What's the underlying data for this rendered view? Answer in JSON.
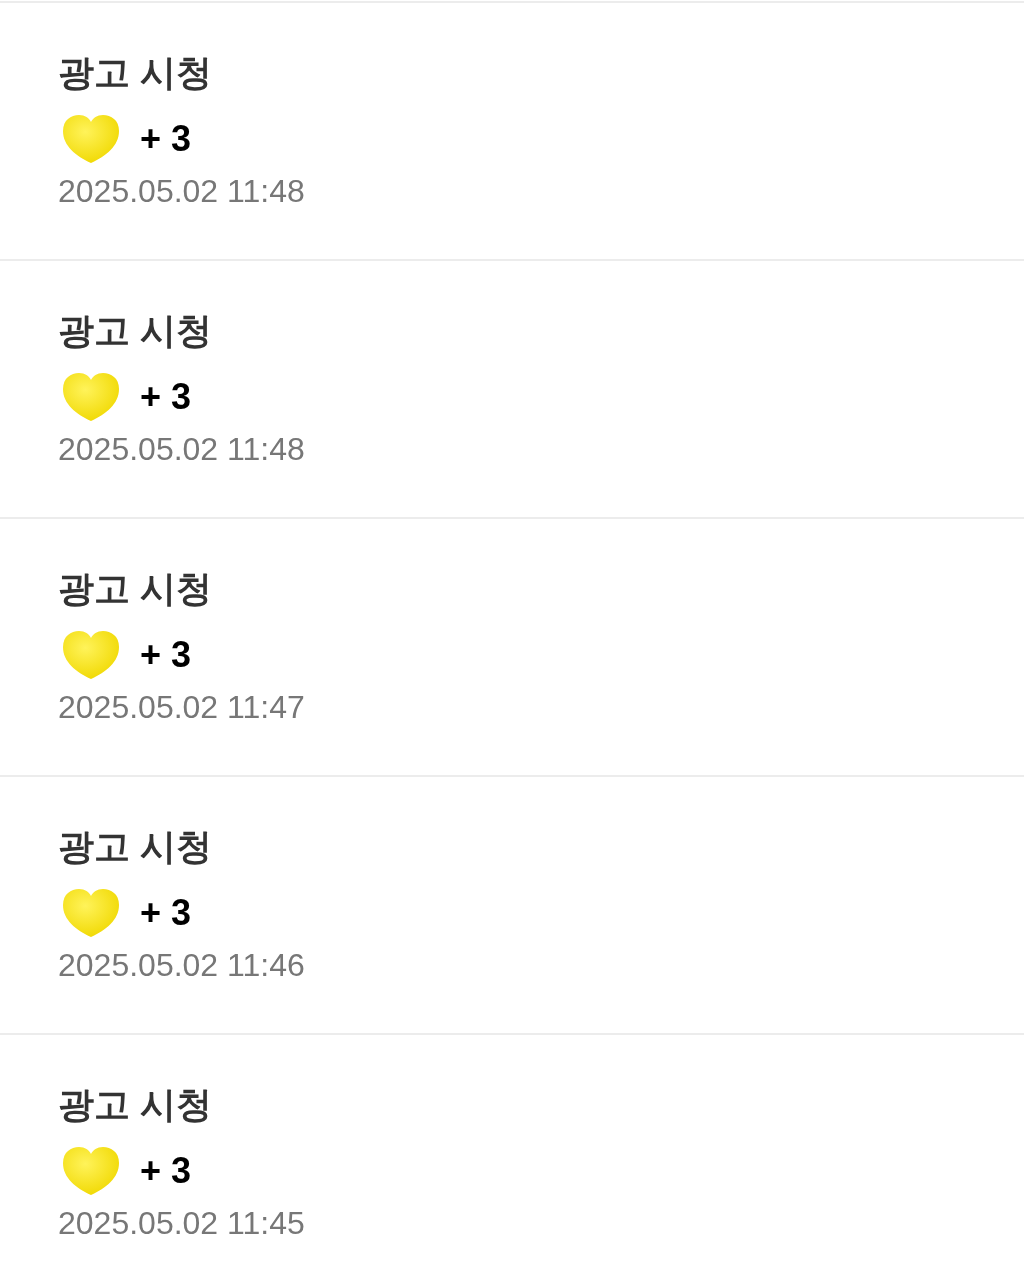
{
  "history": [
    {
      "title": "광고 시청",
      "amount": "+ 3",
      "time": "2025.05.02 11:48"
    },
    {
      "title": "광고 시청",
      "amount": "+ 3",
      "time": "2025.05.02 11:48"
    },
    {
      "title": "광고 시청",
      "amount": "+ 3",
      "time": "2025.05.02 11:47"
    },
    {
      "title": "광고 시청",
      "amount": "+ 3",
      "time": "2025.05.02 11:46"
    },
    {
      "title": "광고 시청",
      "amount": "+ 3",
      "time": "2025.05.02 11:45"
    }
  ]
}
